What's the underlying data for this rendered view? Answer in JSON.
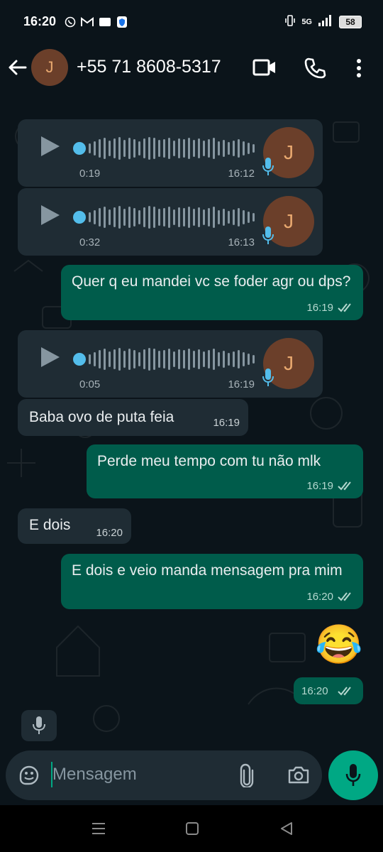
{
  "status_bar": {
    "time": "16:20",
    "network": "5G",
    "battery": "58"
  },
  "header": {
    "avatar_letter": "J",
    "title": "+55 71 8608-5317"
  },
  "messages": [
    {
      "type": "voice",
      "direction": "in",
      "duration": "0:19",
      "time": "16:12",
      "avatar_letter": "J"
    },
    {
      "type": "voice",
      "direction": "in",
      "duration": "0:32",
      "time": "16:13",
      "avatar_letter": "J"
    },
    {
      "type": "text",
      "direction": "out",
      "text": "Quer q eu mandei vc se foder agr ou dps?",
      "time": "16:19"
    },
    {
      "type": "voice",
      "direction": "in",
      "duration": "0:05",
      "time": "16:19",
      "avatar_letter": "J"
    },
    {
      "type": "text",
      "direction": "in",
      "text": "Baba ovo de puta feia",
      "time": "16:19"
    },
    {
      "type": "text",
      "direction": "out",
      "text": "Perde meu tempo com tu não mlk",
      "time": "16:19"
    },
    {
      "type": "text",
      "direction": "in",
      "text": "E dois",
      "time": "16:20"
    },
    {
      "type": "text",
      "direction": "out",
      "text": "E dois e veio manda mensagem pra mim",
      "time": "16:20"
    },
    {
      "type": "emoji",
      "direction": "out",
      "emoji": "😂",
      "time": "16:20"
    }
  ],
  "composer": {
    "placeholder": "Mensagem"
  },
  "colors": {
    "background": "#0b141a",
    "incoming_bubble": "#1f2c34",
    "outgoing_bubble": "#005c4b",
    "accent": "#00a884",
    "voice_dot": "#53bdeb"
  }
}
